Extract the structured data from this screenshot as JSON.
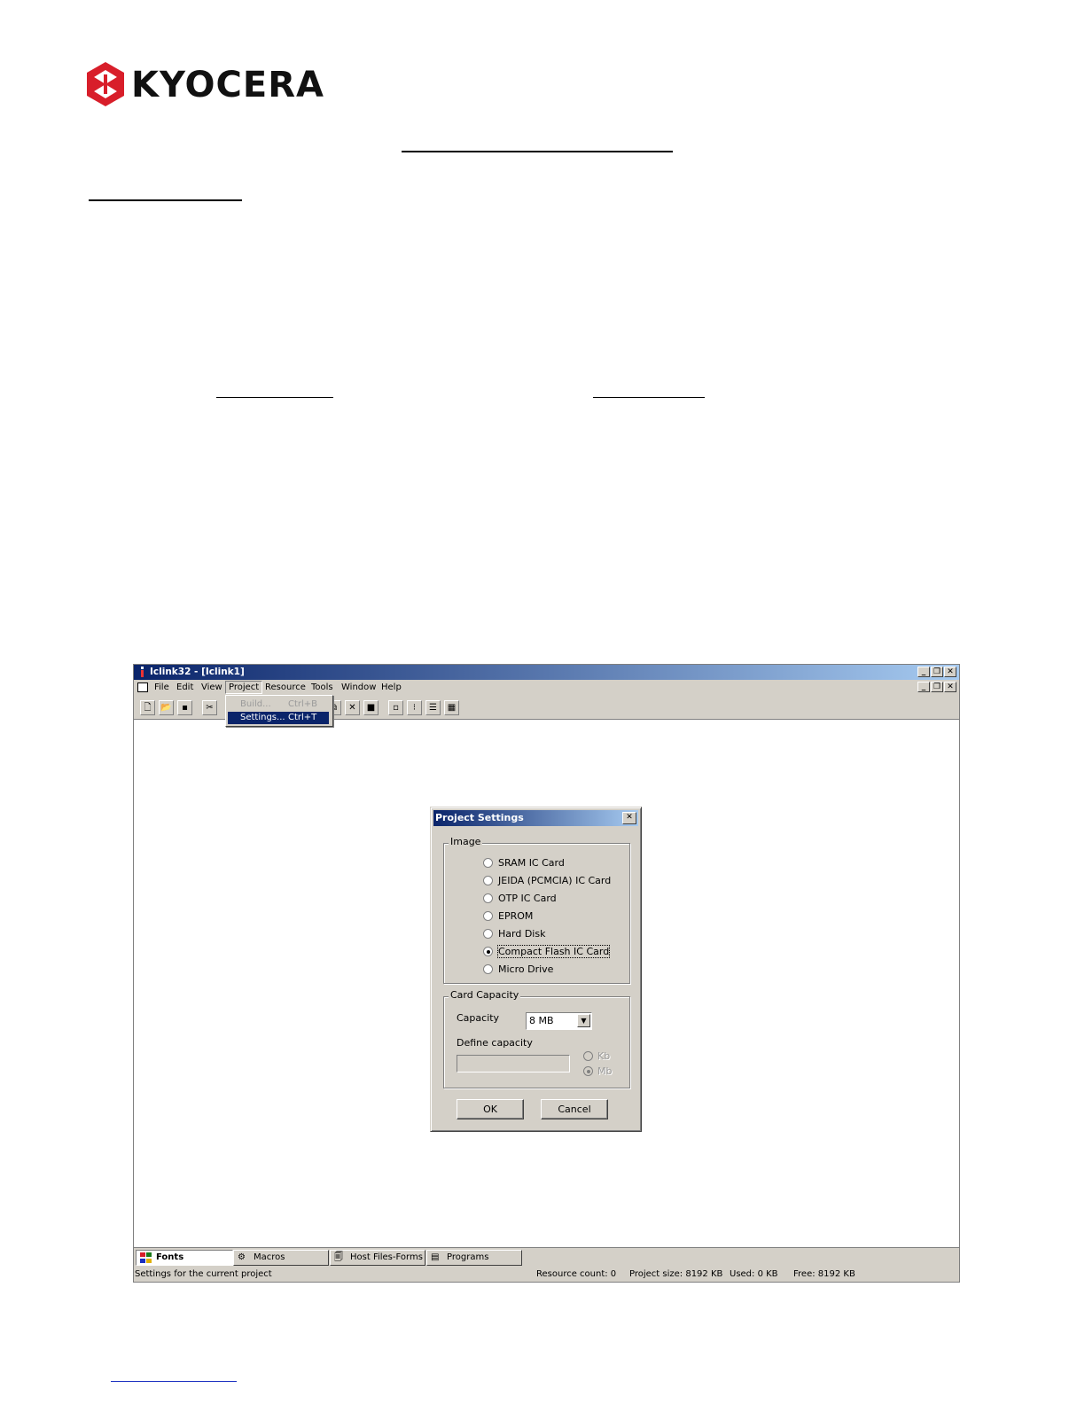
{
  "brand": {
    "name": "KYOCERA"
  },
  "app": {
    "title": "Iclink32 - [Iclink1]",
    "menu": [
      "File",
      "Edit",
      "View",
      "Project",
      "Resource",
      "Tools",
      "Window",
      "Help"
    ],
    "project_menu": [
      {
        "label": "Build...",
        "shortcut": "Ctrl+B"
      },
      {
        "label": "Settings...",
        "shortcut": "Ctrl+T"
      }
    ],
    "window_buttons": [
      "_",
      "❐",
      "✕"
    ]
  },
  "dialog": {
    "title": "Project Settings",
    "image_group": "Image",
    "image_options": [
      "SRAM IC Card",
      "JEIDA (PCMCIA) IC Card",
      "OTP IC Card",
      "EPROM",
      "Hard Disk",
      "Compact Flash IC Card",
      "Micro Drive"
    ],
    "selected_image": "Compact Flash IC Card",
    "capacity_group": "Card Capacity",
    "capacity_label": "Capacity",
    "capacity_value": "8 MB",
    "define_label": "Define capacity",
    "unit_kb": "Kb",
    "unit_mb": "Mb",
    "ok": "OK",
    "cancel": "Cancel"
  },
  "tabs": [
    "Fonts",
    "Macros",
    "Host Files-Forms",
    "Programs"
  ],
  "status": {
    "message": "Settings for the current project",
    "resource_count": "Resource count:  0",
    "project_size": "Project size: 8192 KB",
    "used": "Used: 0 KB",
    "free": "Free: 8192 KB"
  },
  "colors": {
    "logo_red": "#d81e2a",
    "title_blue": "#0a246a",
    "face": "#d4d0c8"
  }
}
